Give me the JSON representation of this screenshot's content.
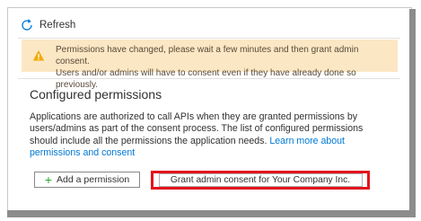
{
  "toolbar": {
    "refresh_label": "Refresh",
    "refresh_icon": "refresh-icon"
  },
  "banner": {
    "icon": "warning-icon",
    "line1": "Permissions have changed, please wait a few minutes and then grant admin consent.",
    "line2": "Users and/or admins will have to consent even if they have already done so previously.",
    "bg_color": "#fbe7c4",
    "icon_color": "#f2a900"
  },
  "section": {
    "title": "Configured permissions",
    "description": "Applications are authorized to call APIs when they are granted permissions by users/admins as part of the consent process. The list of configured permissions should include all the permissions the application needs.",
    "link_text": "Learn more about permissions and consent"
  },
  "actions": {
    "add_permission_label": "Add a permission",
    "grant_label": "Grant admin consent for Your Company Inc.",
    "highlight_color": "#e3141c",
    "link_color": "#0078d4"
  }
}
